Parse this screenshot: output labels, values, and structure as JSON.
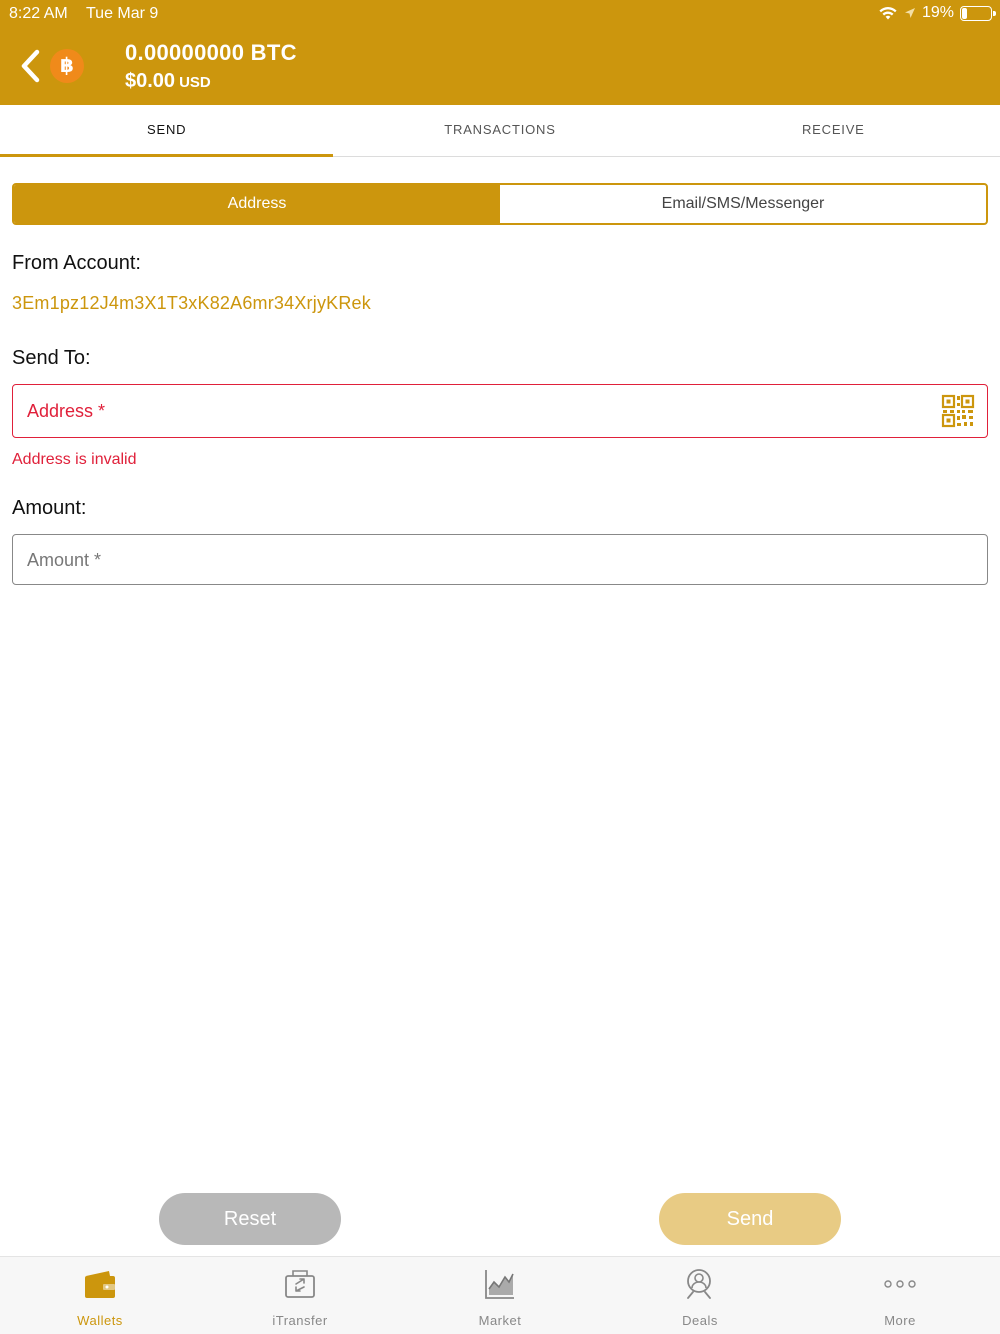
{
  "status_bar": {
    "time": "8:22 AM",
    "date": "Tue Mar 9",
    "battery": "19%",
    "battery_level": 0.19,
    "icons": [
      "wifi-icon",
      "location-arrow-icon",
      "battery-icon"
    ]
  },
  "header": {
    "coin_symbol": "฿",
    "balance_btc": "0.00000000 BTC",
    "balance_usd": "$0.00",
    "currency": "USD"
  },
  "tabs": [
    {
      "label": "SEND",
      "active": true
    },
    {
      "label": "TRANSACTIONS",
      "active": false
    },
    {
      "label": "RECEIVE",
      "active": false
    }
  ],
  "segment": {
    "address_label": "Address",
    "email_label": "Email/SMS/Messenger",
    "selected": "Address"
  },
  "form": {
    "from_label": "From Account:",
    "from_address": "3Em1pz12J4m3X1T3xK82A6mr34XrjyKRek",
    "send_to_label": "Send To:",
    "address_placeholder": "Address *",
    "address_value": "",
    "address_error": "Address is invalid",
    "amount_label": "Amount:",
    "amount_placeholder": "Amount *",
    "amount_value": ""
  },
  "buttons": {
    "reset": "Reset",
    "send": "Send"
  },
  "bottom_nav": [
    {
      "label": "Wallets",
      "icon": "wallet-icon",
      "active": true
    },
    {
      "label": "iTransfer",
      "icon": "itransfer-icon",
      "active": false
    },
    {
      "label": "Market",
      "icon": "chart-icon",
      "active": false
    },
    {
      "label": "Deals",
      "icon": "deals-search-icon",
      "active": false
    },
    {
      "label": "More",
      "icon": "more-dots-icon",
      "active": false
    }
  ],
  "colors": {
    "brand": "#CC960D",
    "error": "#E0203A",
    "coin": "#F08A1A",
    "disabled_send": "#E8CB84",
    "reset": "#B8B8B8"
  }
}
